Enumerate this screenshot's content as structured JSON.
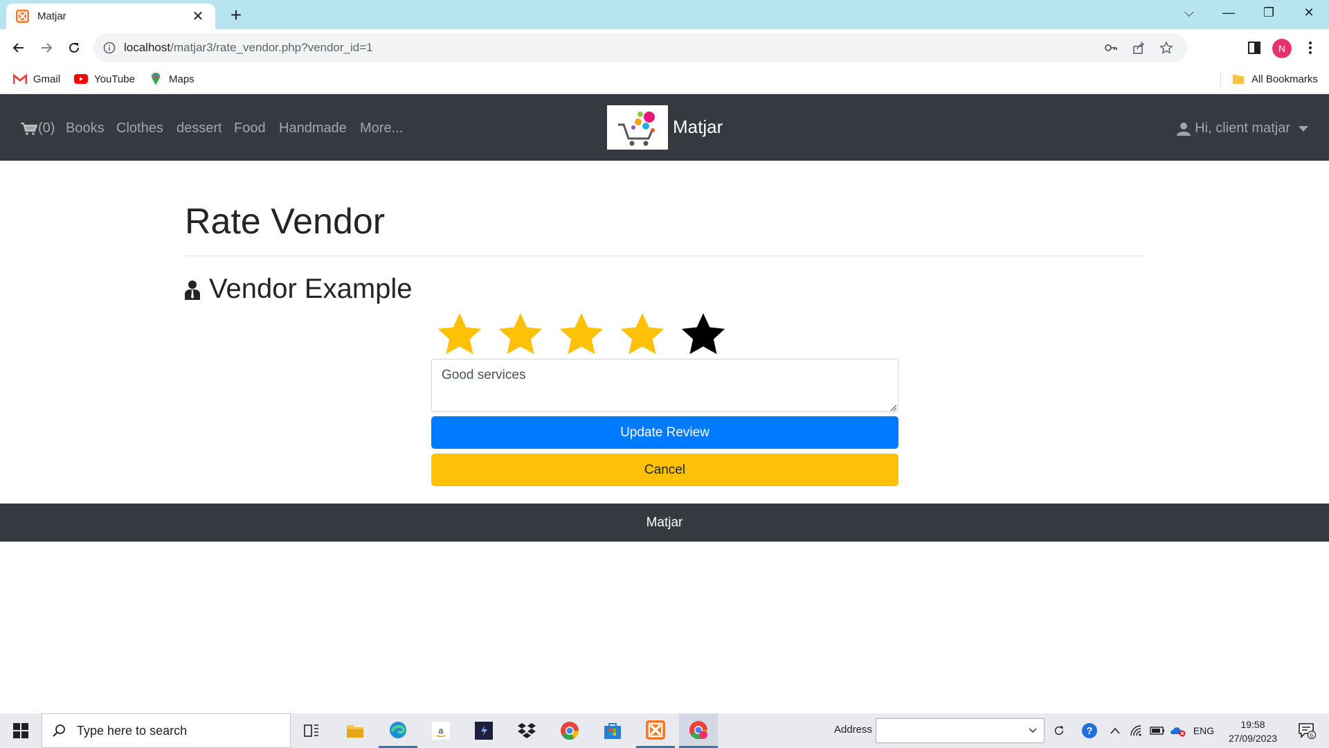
{
  "browser": {
    "tab_title": "Matjar",
    "new_tab": "+",
    "url_host": "localhost",
    "url_path": "/matjar3/rate_vendor.php?vendor_id=1",
    "profile_initial": "N",
    "bookmarks": [
      {
        "label": "Gmail",
        "icon": "gmail-icon"
      },
      {
        "label": "YouTube",
        "icon": "youtube-icon"
      },
      {
        "label": "Maps",
        "icon": "maps-icon"
      }
    ],
    "all_bookmarks": "All Bookmarks"
  },
  "site": {
    "cart_label": "(0)",
    "nav": [
      "Books",
      "Clothes",
      "dessert",
      "Food",
      "Handmade",
      "More..."
    ],
    "brand": "Matjar",
    "user_menu": "Hi, client matjar",
    "colors": {
      "navbar": "#343a40",
      "primary": "#007bff",
      "warning": "#ffc107",
      "star_filled": "#ffc107",
      "star_empty": "#000000"
    }
  },
  "page": {
    "title": "Rate Vendor",
    "vendor_name": "Vendor Example",
    "rating": {
      "value": 4,
      "max": 5
    },
    "review_text": "Good services",
    "update_button": "Update Review",
    "cancel_button": "Cancel",
    "footer": "Matjar"
  },
  "taskbar": {
    "search_placeholder": "Type here to search",
    "address_label": "Address",
    "language": "ENG",
    "time": "19:58",
    "date": "27/09/2023",
    "notification_count": "6"
  }
}
